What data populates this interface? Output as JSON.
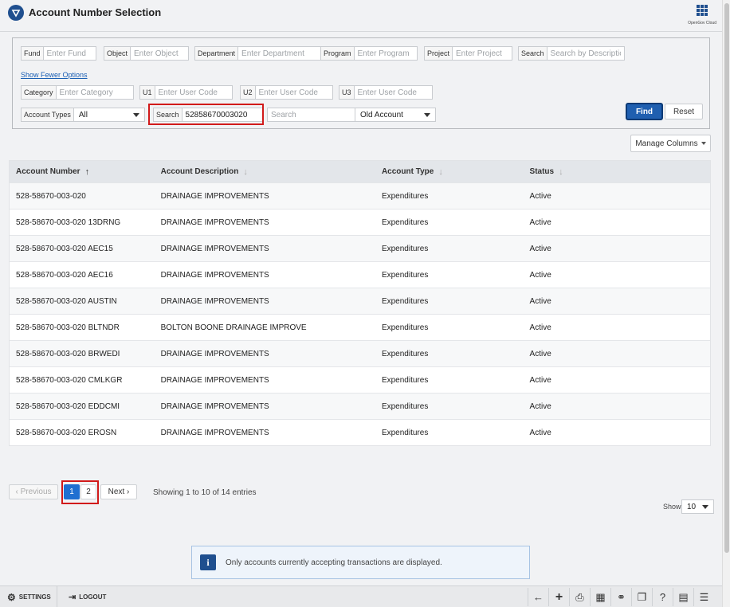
{
  "header": {
    "title": "Account Number Selection",
    "brand": "OpenGov Cloud"
  },
  "filters": {
    "fund": {
      "label": "Fund",
      "placeholder": "Enter Fund"
    },
    "object": {
      "label": "Object",
      "placeholder": "Enter Object"
    },
    "department": {
      "label": "Department",
      "placeholder": "Enter Department"
    },
    "program": {
      "label": "Program",
      "placeholder": "Enter Program"
    },
    "project": {
      "label": "Project",
      "placeholder": "Enter Project"
    },
    "search_desc": {
      "label": "Search",
      "placeholder": "Search by Description"
    },
    "fewer_link": "Show Fewer Options",
    "category": {
      "label": "Category",
      "placeholder": "Enter Category"
    },
    "u1": {
      "label": "U1",
      "placeholder": "Enter User Code"
    },
    "u2": {
      "label": "U2",
      "placeholder": "Enter User Code"
    },
    "u3": {
      "label": "U3",
      "placeholder": "Enter User Code"
    },
    "account_types": {
      "label": "Account Types",
      "value": "All"
    },
    "search_num": {
      "label": "Search",
      "value": "52858670003020"
    },
    "search_old": {
      "placeholder": "Search"
    },
    "old_account": {
      "value": "Old Account"
    },
    "find_label": "Find",
    "reset_label": "Reset"
  },
  "manage_columns": "Manage Columns",
  "table": {
    "columns": [
      "Account Number",
      "Account Description",
      "Account  Type",
      "Status"
    ],
    "rows": [
      [
        "528-58670-003-020",
        "DRAINAGE IMPROVEMENTS",
        "Expenditures",
        "Active"
      ],
      [
        "528-58670-003-020 13DRNG",
        "DRAINAGE IMPROVEMENTS",
        "Expenditures",
        "Active"
      ],
      [
        "528-58670-003-020 AEC15",
        "DRAINAGE IMPROVEMENTS",
        "Expenditures",
        "Active"
      ],
      [
        "528-58670-003-020 AEC16",
        "DRAINAGE IMPROVEMENTS",
        "Expenditures",
        "Active"
      ],
      [
        "528-58670-003-020 AUSTIN",
        "DRAINAGE IMPROVEMENTS",
        "Expenditures",
        "Active"
      ],
      [
        "528-58670-003-020 BLTNDR",
        "BOLTON BOONE DRAINAGE IMPROVE",
        "Expenditures",
        "Active"
      ],
      [
        "528-58670-003-020 BRWEDI",
        "DRAINAGE IMPROVEMENTS",
        "Expenditures",
        "Active"
      ],
      [
        "528-58670-003-020 CMLKGR",
        "DRAINAGE IMPROVEMENTS",
        "Expenditures",
        "Active"
      ],
      [
        "528-58670-003-020 EDDCMI",
        "DRAINAGE IMPROVEMENTS",
        "Expenditures",
        "Active"
      ],
      [
        "528-58670-003-020 EROSN",
        "DRAINAGE IMPROVEMENTS",
        "Expenditures",
        "Active"
      ]
    ]
  },
  "pagination": {
    "prev": "Previous",
    "pages": [
      "1",
      "2"
    ],
    "next": "Next",
    "showing": "Showing 1 to 10 of 14 entries",
    "show_label": "Show",
    "show_value": "10"
  },
  "info": "Only accounts currently accepting transactions are displayed.",
  "footer": {
    "settings": "SETTINGS",
    "logout": "LOGOUT"
  },
  "tools": [
    "back-arrow-icon",
    "plus-icon",
    "print-icon",
    "grid-icon",
    "binoculars-icon",
    "comments-icon",
    "help-icon",
    "calendar-icon",
    "tree-icon"
  ]
}
